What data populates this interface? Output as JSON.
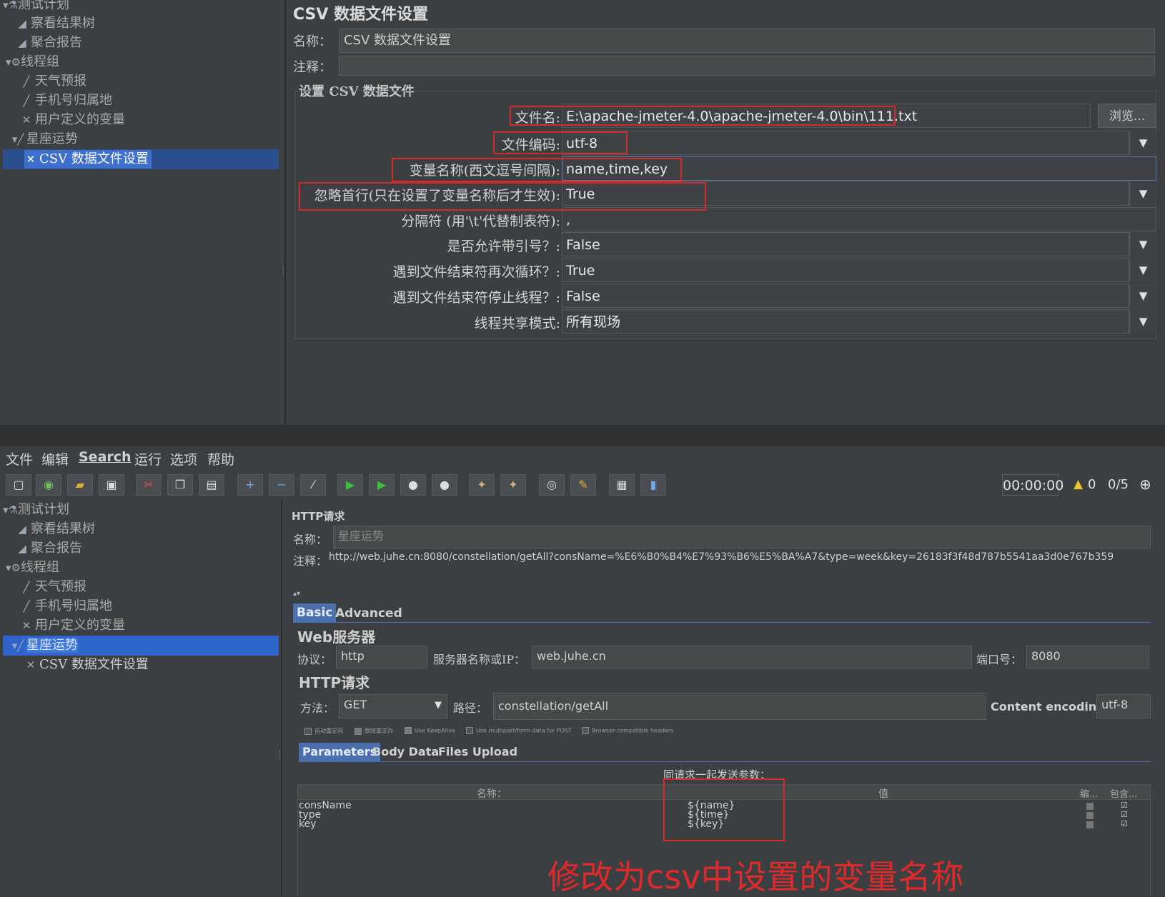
{
  "top": {
    "tree": [
      {
        "label": "测试计划",
        "icon": "flask-icon"
      },
      {
        "label": "察看结果树",
        "icon": "chart-icon"
      },
      {
        "label": "聚合报告",
        "icon": "chart-icon"
      },
      {
        "label": "线程组",
        "icon": "gear-icon"
      },
      {
        "label": "天气预报",
        "icon": "pencil-icon"
      },
      {
        "label": "手机号归属地",
        "icon": "pencil-icon"
      },
      {
        "label": "用户定义的变量",
        "icon": "wrench-icon"
      },
      {
        "label": "星座运势",
        "icon": "pencil-icon"
      },
      {
        "label": "CSV 数据文件设置",
        "icon": "wrench-icon"
      }
    ],
    "title": "CSV 数据文件设置",
    "name_label": "名称：",
    "name_value": "CSV 数据文件设置",
    "comment_label": "注释：",
    "section_title": "设置 CSV 数据文件",
    "rows": [
      {
        "label": "文件名:",
        "value": "E:\\apache-jmeter-4.0\\apache-jmeter-4.0\\bin\\111.txt"
      },
      {
        "label": "文件编码:",
        "value": "utf-8"
      },
      {
        "label": "变量名称(西文逗号间隔):",
        "value": "name,time,key"
      },
      {
        "label": "忽略首行(只在设置了变量名称后才生效):",
        "value": "True"
      },
      {
        "label": "分隔符 (用'\\t'代替制表符):",
        "value": ","
      },
      {
        "label": "是否允许带引号？:",
        "value": "False"
      },
      {
        "label": "遇到文件结束符再次循环？:",
        "value": "True"
      },
      {
        "label": "遇到文件结束符停止线程？:",
        "value": "False"
      },
      {
        "label": "线程共享模式:",
        "value": "所有现场"
      }
    ],
    "browse_label": "浏览..."
  },
  "menu": [
    "文件",
    "编辑",
    "Search",
    "运行",
    "选项",
    "帮助"
  ],
  "status": {
    "timer": "00:00:00",
    "warnings": "0",
    "threads": "0/5"
  },
  "bottom": {
    "tree": [
      {
        "label": "测试计划"
      },
      {
        "label": "察看结果树"
      },
      {
        "label": "聚合报告"
      },
      {
        "label": "线程组"
      },
      {
        "label": "天气预报"
      },
      {
        "label": "手机号归属地"
      },
      {
        "label": "用户定义的变量"
      },
      {
        "label": "星座运势"
      },
      {
        "label": "CSV 数据文件设置"
      }
    ],
    "title": "HTTP请求",
    "name_label": "名称：",
    "name_value": "星座运势",
    "comment_label": "注释：",
    "comment_value": "http://web.juhe.cn:8080/constellation/getAll?consName=%E6%B0%B4%E7%93%B6%E5%BA%A7&type=week&key=26183f3f48d787b5541aa3d0e767b359",
    "tabs": [
      "Basic",
      "Advanced"
    ],
    "web_server_title": "Web服务器",
    "protocol_label": "协议：",
    "protocol_value": "http",
    "server_label": "服务器名称或IP：",
    "server_value": "web.juhe.cn",
    "port_label": "端口号：",
    "port_value": "8080",
    "http_request_title": "HTTP请求",
    "method_label": "方法：",
    "method_value": "GET",
    "path_label": "路径：",
    "path_value": "constellation/getAll",
    "encoding_label": "Content encoding:",
    "encoding_value": "utf-8",
    "checkboxes": [
      "自动重定向",
      "跟随重定向",
      "Use KeepAlive",
      "Use multipart/form-data for POST",
      "Browser-compatible headers"
    ],
    "param_tabs": [
      "Parameters",
      "Body Data",
      "Files Upload"
    ],
    "params_caption": "同请求一起发送参数：",
    "table_headers": [
      "名称：",
      "值",
      "编...",
      "包含..."
    ],
    "params": [
      {
        "name": "consName",
        "value": "${name}"
      },
      {
        "name": "type",
        "value": "${time}"
      },
      {
        "name": "key",
        "value": "${key}"
      }
    ]
  },
  "annotation": "修改为csv中设置的变量名称",
  "colors": {
    "background": "#3c3f41",
    "selection": "#2f65ca",
    "highlight_red": "#d42a2a",
    "annotation_red": "#e0292b"
  }
}
